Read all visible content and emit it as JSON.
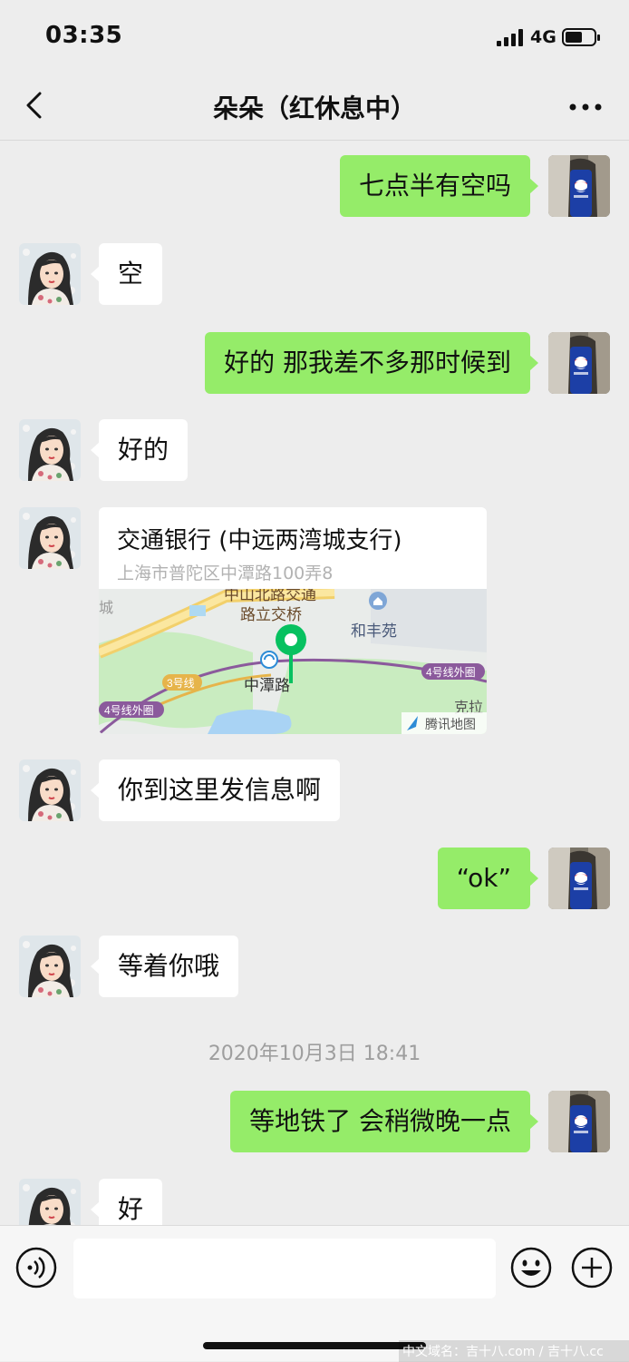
{
  "status_bar": {
    "time": "03:35",
    "network": "4G",
    "battery_level": 0.6
  },
  "header": {
    "title": "朵朵（红休息中）"
  },
  "messages": {
    "m1": "七点半有空吗",
    "m2": "空",
    "m3": "好的   那我差不多那时候到",
    "m4": "好的",
    "location": {
      "title": "交通银行 (中远两湾城支行)",
      "address": "上海市普陀区中潭路100弄8",
      "map_labels": [
        "中山北路交通",
        "路立交桥",
        "和丰苑",
        "中潭路",
        "3号线",
        "4号线外圈",
        "4号线外圈",
        "克拉",
        "城",
        "腾讯地图"
      ]
    },
    "m5": "你到这里发信息啊",
    "m6": "“ok”",
    "m7": "等着你哦",
    "timestamp": "2020年10月3日 18:41",
    "m8": "等地铁了  会稍微晚一点",
    "m9": "好"
  },
  "input": {
    "value": ""
  },
  "watermark": "中文域名：吉十八.com / 吉十八.cc",
  "colors": {
    "background": "#ededed",
    "sent_bubble": "#95ec69",
    "received_bubble": "#ffffff",
    "map_pin": "#07c160"
  },
  "icons": {
    "back": "chevron-left-icon",
    "more": "more-dots-icon",
    "voice": "voice-icon",
    "emoji": "emoji-icon",
    "plus": "plus-circle-icon"
  }
}
